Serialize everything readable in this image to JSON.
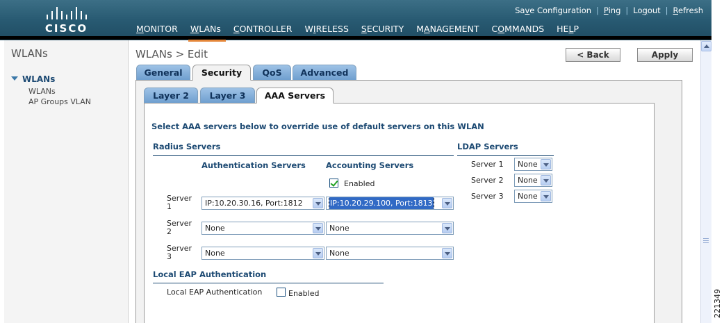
{
  "header": {
    "brand": "CISCO",
    "top_links": [
      {
        "prefix": "Sa",
        "key": "v",
        "suffix": "e Configuration"
      },
      {
        "prefix": "",
        "key": "P",
        "suffix": "ing"
      },
      {
        "prefix": "Lo",
        "key": "g",
        "suffix": "out"
      },
      {
        "prefix": "",
        "key": "R",
        "suffix": "efresh"
      }
    ],
    "menu": [
      {
        "prefix": "",
        "key": "M",
        "suffix": "ONITOR",
        "active": false
      },
      {
        "prefix": "",
        "key": "W",
        "suffix": "LANs",
        "active": true
      },
      {
        "prefix": "",
        "key": "C",
        "suffix": "ONTROLLER",
        "active": false
      },
      {
        "prefix": "W",
        "key": "I",
        "suffix": "RELESS",
        "active": false
      },
      {
        "prefix": "",
        "key": "S",
        "suffix": "ECURITY",
        "active": false
      },
      {
        "prefix": "M",
        "key": "A",
        "suffix": "NAGEMENT",
        "active": false
      },
      {
        "prefix": "C",
        "key": "O",
        "suffix": "MMANDS",
        "active": false
      },
      {
        "prefix": "HE",
        "key": "L",
        "suffix": "P",
        "active": false
      }
    ],
    "accent_color": "#e5873a"
  },
  "leftnav": {
    "title": "WLANs",
    "group": "WLANs",
    "items": [
      "WLANs",
      "AP Groups VLAN"
    ]
  },
  "main": {
    "title": "WLANs > Edit",
    "back_label": "< Back",
    "apply_label": "Apply",
    "tabs": [
      "General",
      "Security",
      "QoS",
      "Advanced"
    ],
    "active_tab": "Security",
    "subtabs": [
      "Layer 2",
      "Layer 3",
      "AAA Servers"
    ],
    "active_subtab": "AAA Servers",
    "description": "Select AAA servers below to override use of default servers on this WLAN",
    "radius": {
      "title": "Radius Servers",
      "auth_header": "Authentication Servers",
      "acct_header": "Accounting Servers",
      "acct_enabled_label": "Enabled",
      "acct_enabled": true,
      "servers": [
        {
          "label_1": "Server",
          "label_2": "1",
          "auth": "IP:10.20.30.16, Port:1812",
          "acct": "IP:10.20.29.100, Port:1813"
        },
        {
          "label_1": "Server",
          "label_2": "2",
          "auth": "None",
          "acct": "None"
        },
        {
          "label_1": "Server",
          "label_2": "3",
          "auth": "None",
          "acct": "None"
        }
      ]
    },
    "ldap": {
      "title": "LDAP Servers",
      "servers": [
        {
          "label": "Server 1",
          "value": "None"
        },
        {
          "label": "Server 2",
          "value": "None"
        },
        {
          "label": "Server 3",
          "value": "None"
        }
      ]
    },
    "local_eap": {
      "title": "Local EAP Authentication",
      "label": "Local EAP Authentication",
      "enabled_label": "Enabled",
      "enabled": false
    }
  },
  "figure_id": "221349"
}
